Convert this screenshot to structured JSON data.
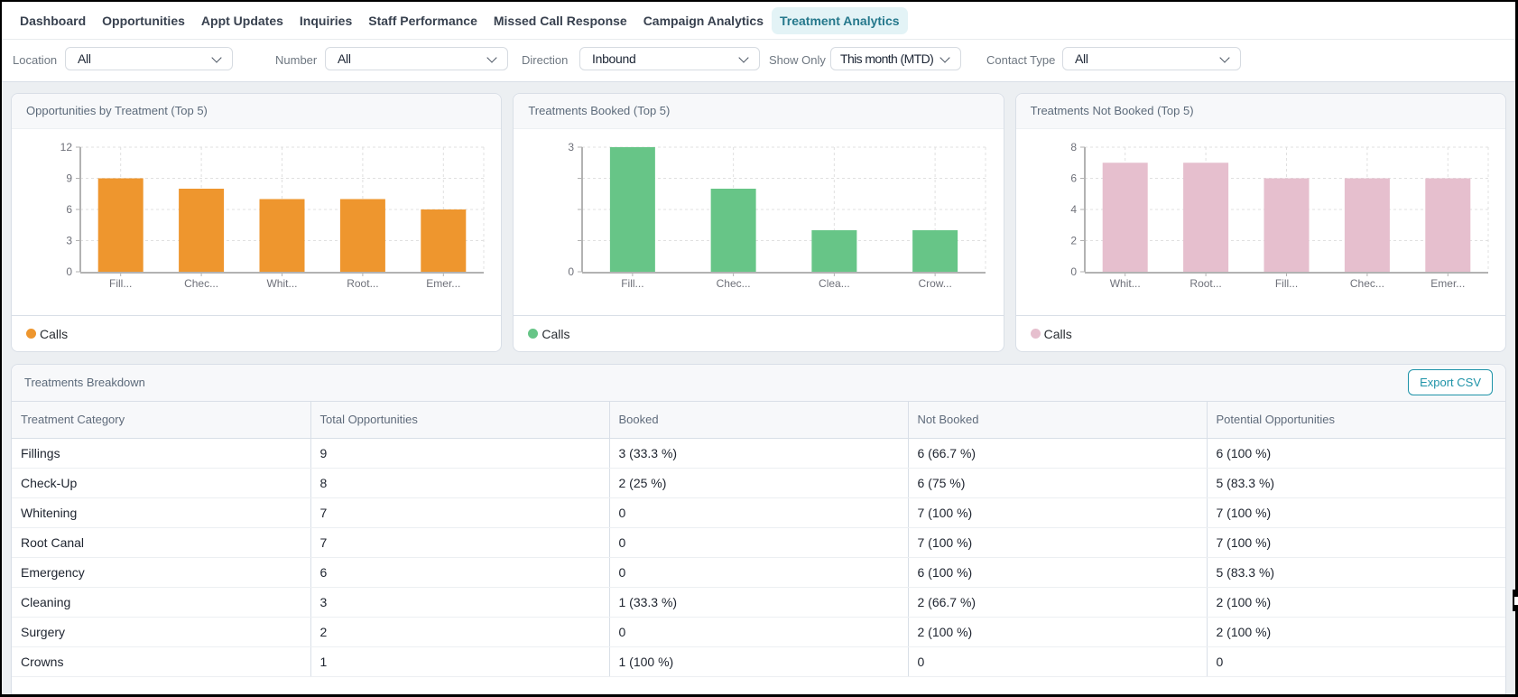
{
  "nav": {
    "items": [
      {
        "label": "Dashboard",
        "active": false
      },
      {
        "label": "Opportunities",
        "active": false
      },
      {
        "label": "Appt Updates",
        "active": false
      },
      {
        "label": "Inquiries",
        "active": false
      },
      {
        "label": "Staff Performance",
        "active": false
      },
      {
        "label": "Missed Call Response",
        "active": false
      },
      {
        "label": "Campaign Analytics",
        "active": false
      },
      {
        "label": "Treatment Analytics",
        "active": true
      }
    ]
  },
  "filters": [
    {
      "label": "Location",
      "value": "All"
    },
    {
      "label": "Number",
      "value": "All"
    },
    {
      "label": "Direction",
      "value": "Inbound"
    },
    {
      "label": "Show Only",
      "value": "This month (MTD)"
    },
    {
      "label": "Contact Type",
      "value": "All"
    }
  ],
  "colors": {
    "active_tab_bg": "#e3f3f6",
    "active_tab_text": "#25788c",
    "orange": "#ee962e",
    "green": "#67c587",
    "pink": "#e6bfce",
    "teal_button": "#2d93a8"
  },
  "chart_data": [
    {
      "type": "bar",
      "title": "Opportunities by Treatment (Top 5)",
      "categories": [
        "Fill...",
        "Chec...",
        "Whit...",
        "Root...",
        "Emer..."
      ],
      "values": [
        9,
        8,
        7,
        7,
        6
      ],
      "ylim": [
        0,
        12
      ],
      "ytick_labels": [
        "0",
        "3",
        "6",
        "9",
        "12"
      ],
      "series_name": "Calls",
      "color": "#ee962e",
      "grid": true,
      "legend_position": "bottom"
    },
    {
      "type": "bar",
      "title": "Treatments Booked (Top 5)",
      "categories": [
        "Fill...",
        "Chec...",
        "Clea...",
        "Crow..."
      ],
      "values": [
        3,
        2,
        1,
        1
      ],
      "ylim": [
        0,
        3
      ],
      "ytick_labels": [
        "0",
        "",
        "",
        "",
        "3"
      ],
      "series_name": "Calls",
      "color": "#67c587",
      "grid": true,
      "legend_position": "bottom"
    },
    {
      "type": "bar",
      "title": "Treatments Not Booked (Top 5)",
      "categories": [
        "Whit...",
        "Root...",
        "Fill...",
        "Chec...",
        "Emer..."
      ],
      "values": [
        7,
        7,
        6,
        6,
        6
      ],
      "ylim": [
        0,
        8
      ],
      "ytick_labels": [
        "0",
        "2",
        "4",
        "6",
        "8"
      ],
      "series_name": "Calls",
      "color": "#e6bfce",
      "grid": true,
      "legend_position": "bottom"
    }
  ],
  "table": {
    "title": "Treatments Breakdown",
    "export_label": "Export CSV",
    "columns": [
      "Treatment Category",
      "Total Opportunities",
      "Booked",
      "Not Booked",
      "Potential Opportunities"
    ],
    "rows": [
      [
        "Fillings",
        "9",
        "3 (33.3 %)",
        "6 (66.7 %)",
        "6 (100 %)"
      ],
      [
        "Check-Up",
        "8",
        "2 (25 %)",
        "6 (75 %)",
        "5 (83.3 %)"
      ],
      [
        "Whitening",
        "7",
        "0",
        "7 (100 %)",
        "7 (100 %)"
      ],
      [
        "Root Canal",
        "7",
        "0",
        "7 (100 %)",
        "7 (100 %)"
      ],
      [
        "Emergency",
        "6",
        "0",
        "6 (100 %)",
        "5 (83.3 %)"
      ],
      [
        "Cleaning",
        "3",
        "1 (33.3 %)",
        "2 (66.7 %)",
        "2 (100 %)"
      ],
      [
        "Surgery",
        "2",
        "0",
        "2 (100 %)",
        "2 (100 %)"
      ],
      [
        "Crowns",
        "1",
        "1 (100 %)",
        "0",
        "0"
      ]
    ]
  }
}
